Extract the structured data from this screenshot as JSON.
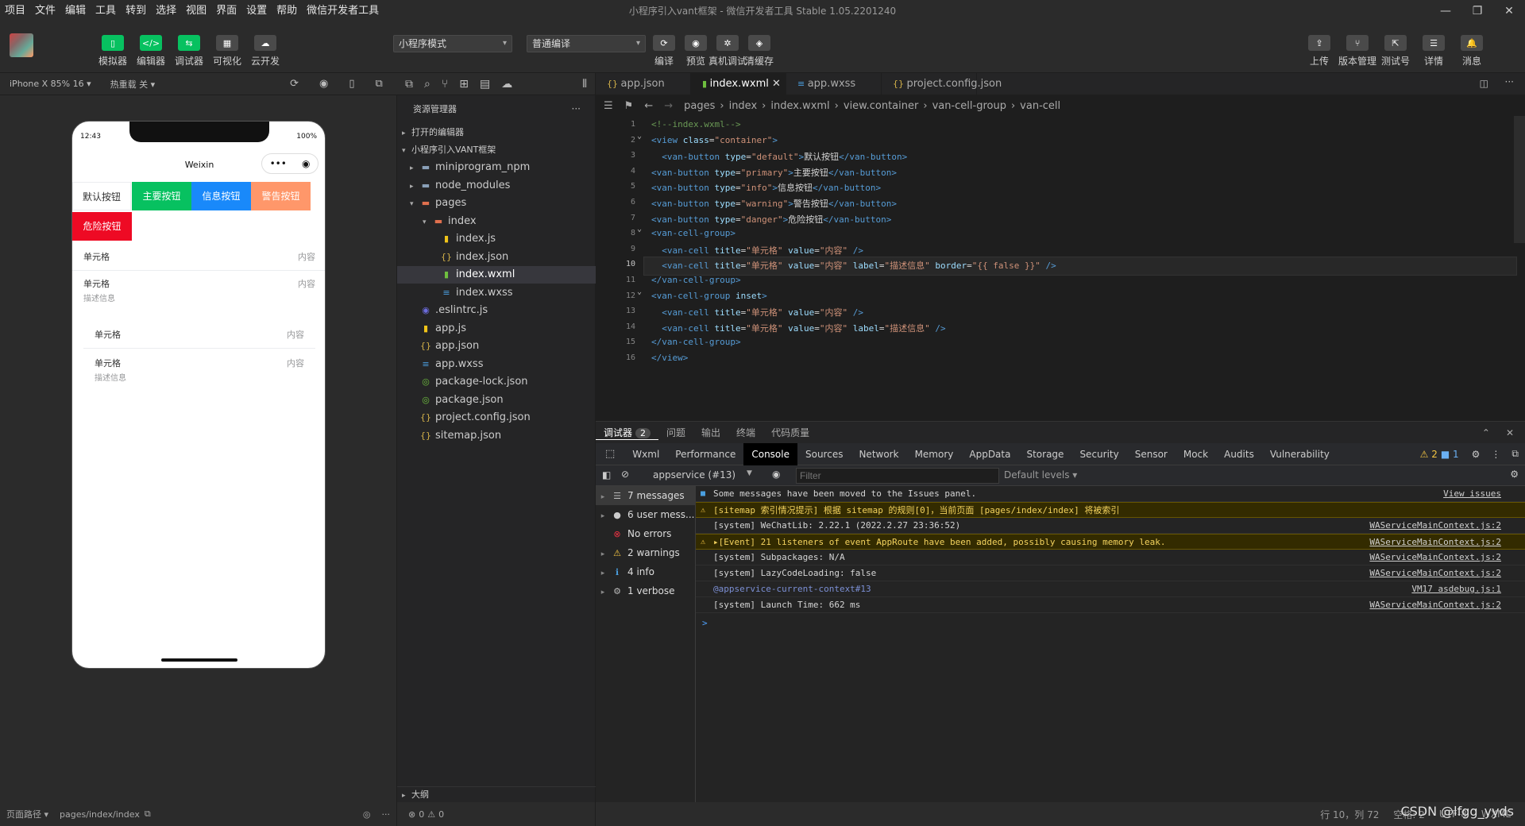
{
  "menu": [
    "项目",
    "文件",
    "编辑",
    "工具",
    "转到",
    "选择",
    "视图",
    "界面",
    "设置",
    "帮助",
    "微信开发者工具"
  ],
  "window_title": "小程序引入vant框架 - 微信开发者工具 Stable 1.05.2201240",
  "toolbar": {
    "left_buttons": [
      {
        "label": "模拟器",
        "icon": "phone-icon"
      },
      {
        "label": "编辑器",
        "icon": "code-icon"
      },
      {
        "label": "调试器",
        "icon": "debug-icon"
      },
      {
        "label": "可视化",
        "icon": "layout-icon"
      },
      {
        "label": "云开发",
        "icon": "cloud-icon"
      }
    ],
    "mode_select": "小程序模式",
    "compile_select": "普通编译",
    "mid_buttons": [
      {
        "label": "编译",
        "icon": "refresh-icon"
      },
      {
        "label": "预览",
        "icon": "eye-icon"
      },
      {
        "label": "真机调试",
        "icon": "bug-icon"
      },
      {
        "label": "清缓存",
        "icon": "layers-icon"
      }
    ],
    "right_buttons": [
      {
        "label": "上传",
        "icon": "upload-icon"
      },
      {
        "label": "版本管理",
        "icon": "branch-icon"
      },
      {
        "label": "测试号",
        "icon": "external-icon"
      },
      {
        "label": "详情",
        "icon": "menu-icon"
      },
      {
        "label": "消息",
        "icon": "bell-icon"
      }
    ]
  },
  "simulator": {
    "device": "iPhone X 85% 16 ▾",
    "hot_reload": "热重载 关 ▾",
    "time": "12:43",
    "battery": "100%",
    "nav_title": "Weixin",
    "buttons": [
      {
        "label": "默认按钮",
        "type": "default",
        "color": "#ffffff"
      },
      {
        "label": "主要按钮",
        "type": "primary",
        "color": "#07c160"
      },
      {
        "label": "信息按钮",
        "type": "info",
        "color": "#1989fa"
      },
      {
        "label": "警告按钮",
        "type": "warning",
        "color": "#ff976a"
      },
      {
        "label": "危险按钮",
        "type": "danger",
        "color": "#ee0a24"
      }
    ],
    "cells": [
      {
        "title": "单元格",
        "value": "内容",
        "label": ""
      },
      {
        "title": "单元格",
        "value": "内容",
        "label": "描述信息"
      },
      {
        "title": "单元格",
        "value": "内容",
        "label": ""
      },
      {
        "title": "单元格",
        "value": "内容",
        "label": "描述信息"
      }
    ],
    "footer_path_label": "页面路径 ▾",
    "footer_path": "pages/index/index"
  },
  "explorer": {
    "title": "资源管理器",
    "sections": [
      "打开的编辑器",
      "小程序引入VANT框架"
    ],
    "items": [
      {
        "name": "miniprogram_npm",
        "kind": "folder",
        "depth": 1,
        "icon": "folder-icon"
      },
      {
        "name": "node_modules",
        "kind": "folder",
        "depth": 1,
        "icon": "folder-icon"
      },
      {
        "name": "pages",
        "kind": "folder-open",
        "depth": 1,
        "icon": "folder-open-icon"
      },
      {
        "name": "index",
        "kind": "folder-open",
        "depth": 2,
        "icon": "folder-open-icon"
      },
      {
        "name": "index.js",
        "kind": "js",
        "depth": 3,
        "icon": "js-file-icon"
      },
      {
        "name": "index.json",
        "kind": "json",
        "depth": 3,
        "icon": "json-file-icon"
      },
      {
        "name": "index.wxml",
        "kind": "wxml",
        "depth": 3,
        "icon": "wxml-file-icon",
        "active": true
      },
      {
        "name": "index.wxss",
        "kind": "wxss",
        "depth": 3,
        "icon": "wxss-file-icon"
      },
      {
        "name": ".eslintrc.js",
        "kind": "eslint",
        "depth": 1,
        "icon": "eslint-file-icon"
      },
      {
        "name": "app.js",
        "kind": "js",
        "depth": 1,
        "icon": "js-file-icon"
      },
      {
        "name": "app.json",
        "kind": "json",
        "depth": 1,
        "icon": "json-file-icon"
      },
      {
        "name": "app.wxss",
        "kind": "wxss",
        "depth": 1,
        "icon": "wxss-file-icon"
      },
      {
        "name": "package-lock.json",
        "kind": "npm",
        "depth": 1,
        "icon": "npm-file-icon"
      },
      {
        "name": "package.json",
        "kind": "npm",
        "depth": 1,
        "icon": "npm-file-icon"
      },
      {
        "name": "project.config.json",
        "kind": "json",
        "depth": 1,
        "icon": "json-file-icon"
      },
      {
        "name": "sitemap.json",
        "kind": "json",
        "depth": 1,
        "icon": "json-file-icon"
      }
    ],
    "outline": "大纲",
    "footer_errors": "0",
    "footer_warnings": "0"
  },
  "tabs": [
    {
      "label": "app.json",
      "icon": "json-file-icon"
    },
    {
      "label": "index.wxml",
      "icon": "wxml-file-icon",
      "active": true
    },
    {
      "label": "app.wxss",
      "icon": "wxss-file-icon"
    },
    {
      "label": "project.config.json",
      "icon": "json-file-icon"
    }
  ],
  "breadcrumbs": [
    "pages",
    "index",
    "index.wxml",
    "view.container",
    "van-cell-group",
    "van-cell"
  ],
  "code_lines": [
    {
      "n": "1",
      "parts": [
        [
          "c",
          "<!--index.wxml-->"
        ]
      ]
    },
    {
      "n": "2",
      "fold": true,
      "parts": [
        [
          "tag",
          "<view "
        ],
        [
          "a",
          "class"
        ],
        [
          "t",
          "="
        ],
        [
          "s",
          "\"container\""
        ],
        [
          "tag",
          ">"
        ]
      ]
    },
    {
      "n": "3",
      "parts": [
        [
          "t",
          "  "
        ],
        [
          "tag",
          "<van-button "
        ],
        [
          "a",
          "type"
        ],
        [
          "t",
          "="
        ],
        [
          "s",
          "\"default\""
        ],
        [
          "tag",
          ">"
        ],
        [
          "t",
          "默认按钮"
        ],
        [
          "tag",
          "</van-button>"
        ]
      ]
    },
    {
      "n": "4",
      "parts": [
        [
          "tag",
          "<van-button "
        ],
        [
          "a",
          "type"
        ],
        [
          "t",
          "="
        ],
        [
          "s",
          "\"primary\""
        ],
        [
          "tag",
          ">"
        ],
        [
          "t",
          "主要按钮"
        ],
        [
          "tag",
          "</van-button>"
        ]
      ]
    },
    {
      "n": "5",
      "parts": [
        [
          "tag",
          "<van-button "
        ],
        [
          "a",
          "type"
        ],
        [
          "t",
          "="
        ],
        [
          "s",
          "\"info\""
        ],
        [
          "tag",
          ">"
        ],
        [
          "t",
          "信息按钮"
        ],
        [
          "tag",
          "</van-button>"
        ]
      ]
    },
    {
      "n": "6",
      "parts": [
        [
          "tag",
          "<van-button "
        ],
        [
          "a",
          "type"
        ],
        [
          "t",
          "="
        ],
        [
          "s",
          "\"warning\""
        ],
        [
          "tag",
          ">"
        ],
        [
          "t",
          "警告按钮"
        ],
        [
          "tag",
          "</van-button>"
        ]
      ]
    },
    {
      "n": "7",
      "parts": [
        [
          "tag",
          "<van-button "
        ],
        [
          "a",
          "type"
        ],
        [
          "t",
          "="
        ],
        [
          "s",
          "\"danger\""
        ],
        [
          "tag",
          ">"
        ],
        [
          "t",
          "危险按钮"
        ],
        [
          "tag",
          "</van-button>"
        ]
      ]
    },
    {
      "n": "8",
      "fold": true,
      "parts": [
        [
          "tag",
          "<van-cell-group>"
        ]
      ]
    },
    {
      "n": "9",
      "parts": [
        [
          "t",
          "  "
        ],
        [
          "tag",
          "<van-cell "
        ],
        [
          "a",
          "title"
        ],
        [
          "t",
          "="
        ],
        [
          "s",
          "\"单元格\""
        ],
        [
          "t",
          " "
        ],
        [
          "a",
          "value"
        ],
        [
          "t",
          "="
        ],
        [
          "s",
          "\"内容\""
        ],
        [
          "t",
          " "
        ],
        [
          "tag",
          "/>"
        ]
      ]
    },
    {
      "n": "10",
      "cur": true,
      "parts": [
        [
          "t",
          "  "
        ],
        [
          "tag",
          "<van-cell "
        ],
        [
          "a",
          "title"
        ],
        [
          "t",
          "="
        ],
        [
          "s",
          "\"单元格\""
        ],
        [
          "t",
          " "
        ],
        [
          "a",
          "value"
        ],
        [
          "t",
          "="
        ],
        [
          "s",
          "\"内容\""
        ],
        [
          "t",
          " "
        ],
        [
          "a",
          "label"
        ],
        [
          "t",
          "="
        ],
        [
          "s",
          "\"描述信息\""
        ],
        [
          "t",
          " "
        ],
        [
          "a",
          "border"
        ],
        [
          "t",
          "="
        ],
        [
          "s",
          "\"{{ false }}\""
        ],
        [
          "t",
          " "
        ],
        [
          "tag",
          "/>"
        ]
      ]
    },
    {
      "n": "11",
      "parts": [
        [
          "tag",
          "</van-cell-group>"
        ]
      ]
    },
    {
      "n": "12",
      "fold": true,
      "parts": [
        [
          "tag",
          "<van-cell-group "
        ],
        [
          "a",
          "inset"
        ],
        [
          "tag",
          ">"
        ]
      ]
    },
    {
      "n": "13",
      "parts": [
        [
          "t",
          "  "
        ],
        [
          "tag",
          "<van-cell "
        ],
        [
          "a",
          "title"
        ],
        [
          "t",
          "="
        ],
        [
          "s",
          "\"单元格\""
        ],
        [
          "t",
          " "
        ],
        [
          "a",
          "value"
        ],
        [
          "t",
          "="
        ],
        [
          "s",
          "\"内容\""
        ],
        [
          "t",
          " "
        ],
        [
          "tag",
          "/>"
        ]
      ]
    },
    {
      "n": "14",
      "parts": [
        [
          "t",
          "  "
        ],
        [
          "tag",
          "<van-cell "
        ],
        [
          "a",
          "title"
        ],
        [
          "t",
          "="
        ],
        [
          "s",
          "\"单元格\""
        ],
        [
          "t",
          " "
        ],
        [
          "a",
          "value"
        ],
        [
          "t",
          "="
        ],
        [
          "s",
          "\"内容\""
        ],
        [
          "t",
          " "
        ],
        [
          "a",
          "label"
        ],
        [
          "t",
          "="
        ],
        [
          "s",
          "\"描述信息\""
        ],
        [
          "t",
          " "
        ],
        [
          "tag",
          "/>"
        ]
      ]
    },
    {
      "n": "15",
      "parts": [
        [
          "tag",
          "</van-cell-group>"
        ]
      ]
    },
    {
      "n": "16",
      "parts": [
        [
          "tag",
          "</view>"
        ]
      ]
    }
  ],
  "panel_tabs": [
    {
      "label": "调试器",
      "badge": "2",
      "active": true
    },
    {
      "label": "问题"
    },
    {
      "label": "输出"
    },
    {
      "label": "终端"
    },
    {
      "label": "代码质量"
    }
  ],
  "devtools_tabs": [
    "Wxml",
    "Performance",
    "Console",
    "Sources",
    "Network",
    "Memory",
    "AppData",
    "Storage",
    "Security",
    "Sensor",
    "Mock",
    "Audits",
    "Vulnerability"
  ],
  "devtools_active": "Console",
  "devtools_counts": {
    "warnings": "2",
    "info": "1"
  },
  "console_bar": {
    "context": "appservice (#13)",
    "filter_placeholder": "Filter",
    "levels": "Default levels ▾"
  },
  "console_sidebar": [
    {
      "label": "7 messages",
      "icon": "list-icon",
      "active": true
    },
    {
      "label": "6 user mess...",
      "icon": "user-icon"
    },
    {
      "label": "No errors",
      "icon": "error-icon"
    },
    {
      "label": "2 warnings",
      "icon": "warning-icon"
    },
    {
      "label": "4 info",
      "icon": "info-icon"
    },
    {
      "label": "1 verbose",
      "icon": "gear-icon"
    }
  ],
  "console_rows": [
    {
      "text": "Some messages have been moved to the Issues panel.",
      "src": "View issues",
      "type": "info"
    },
    {
      "text": "[sitemap 索引情况提示] 根据 sitemap 的规则[0]，当前页面 [pages/index/index] 将被索引",
      "src": "",
      "type": "warn"
    },
    {
      "text": "[system] WeChatLib: 2.22.1 (2022.2.27 23:36:52)",
      "src": "WAServiceMainContext.js:2",
      "type": "log"
    },
    {
      "text": "▸[Event] 21 listeners of event AppRoute have been added, possibly causing memory leak.",
      "src": "WAServiceMainContext.js:2",
      "type": "warn"
    },
    {
      "text": "[system] Subpackages: N/A",
      "src": "WAServiceMainContext.js:2",
      "type": "log"
    },
    {
      "text": "[system] LazyCodeLoading: false",
      "src": "WAServiceMainContext.js:2",
      "type": "log"
    },
    {
      "text": "@appservice-current-context#13",
      "src": "VM17 asdebug.js:1",
      "type": "link"
    },
    {
      "text": "[system] Launch Time: 662 ms",
      "src": "WAServiceMainContext.js:2",
      "type": "log"
    }
  ],
  "prompt": ">",
  "statusbar": {
    "position": "行 10，列 72",
    "spaces": "空格: 2",
    "encoding": "UTF-8",
    "lang": "WXML",
    "watermark": "CSDN @lfgg_yyds"
  }
}
